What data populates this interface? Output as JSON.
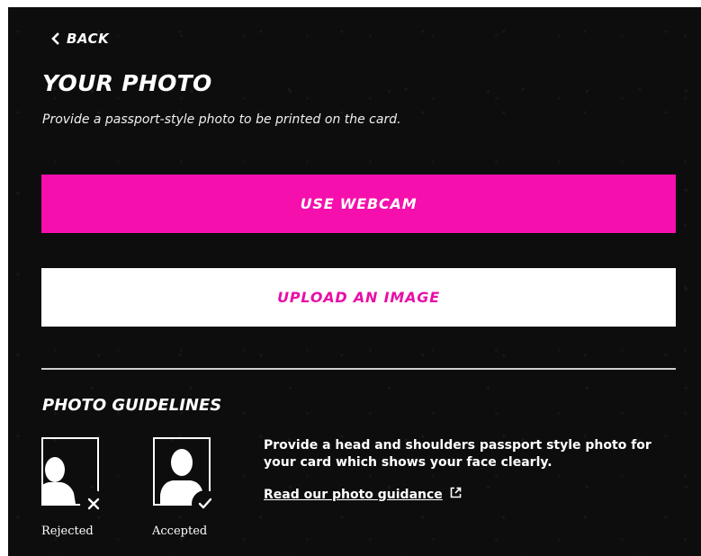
{
  "nav": {
    "back_label": "BACK"
  },
  "page": {
    "title": "YOUR PHOTO",
    "subtitle": "Provide a passport-style photo to be printed on the card."
  },
  "actions": {
    "webcam_label": "USE WEBCAM",
    "upload_label": "UPLOAD AN IMAGE"
  },
  "guidelines": {
    "heading": "PHOTO GUIDELINES",
    "examples": [
      {
        "label": "Rejected",
        "status_icon": "close-icon"
      },
      {
        "label": "Accepted",
        "status_icon": "check-icon"
      }
    ],
    "description": "Provide a head and shoulders passport style photo for your card which shows your face clearly.",
    "link_label": "Read our photo guidance",
    "link_icon": "external-link-icon"
  },
  "colors": {
    "background": "#0d0d0d",
    "accent": "#f50fad",
    "upload_text": "#e80ea6",
    "text": "#ffffff"
  }
}
